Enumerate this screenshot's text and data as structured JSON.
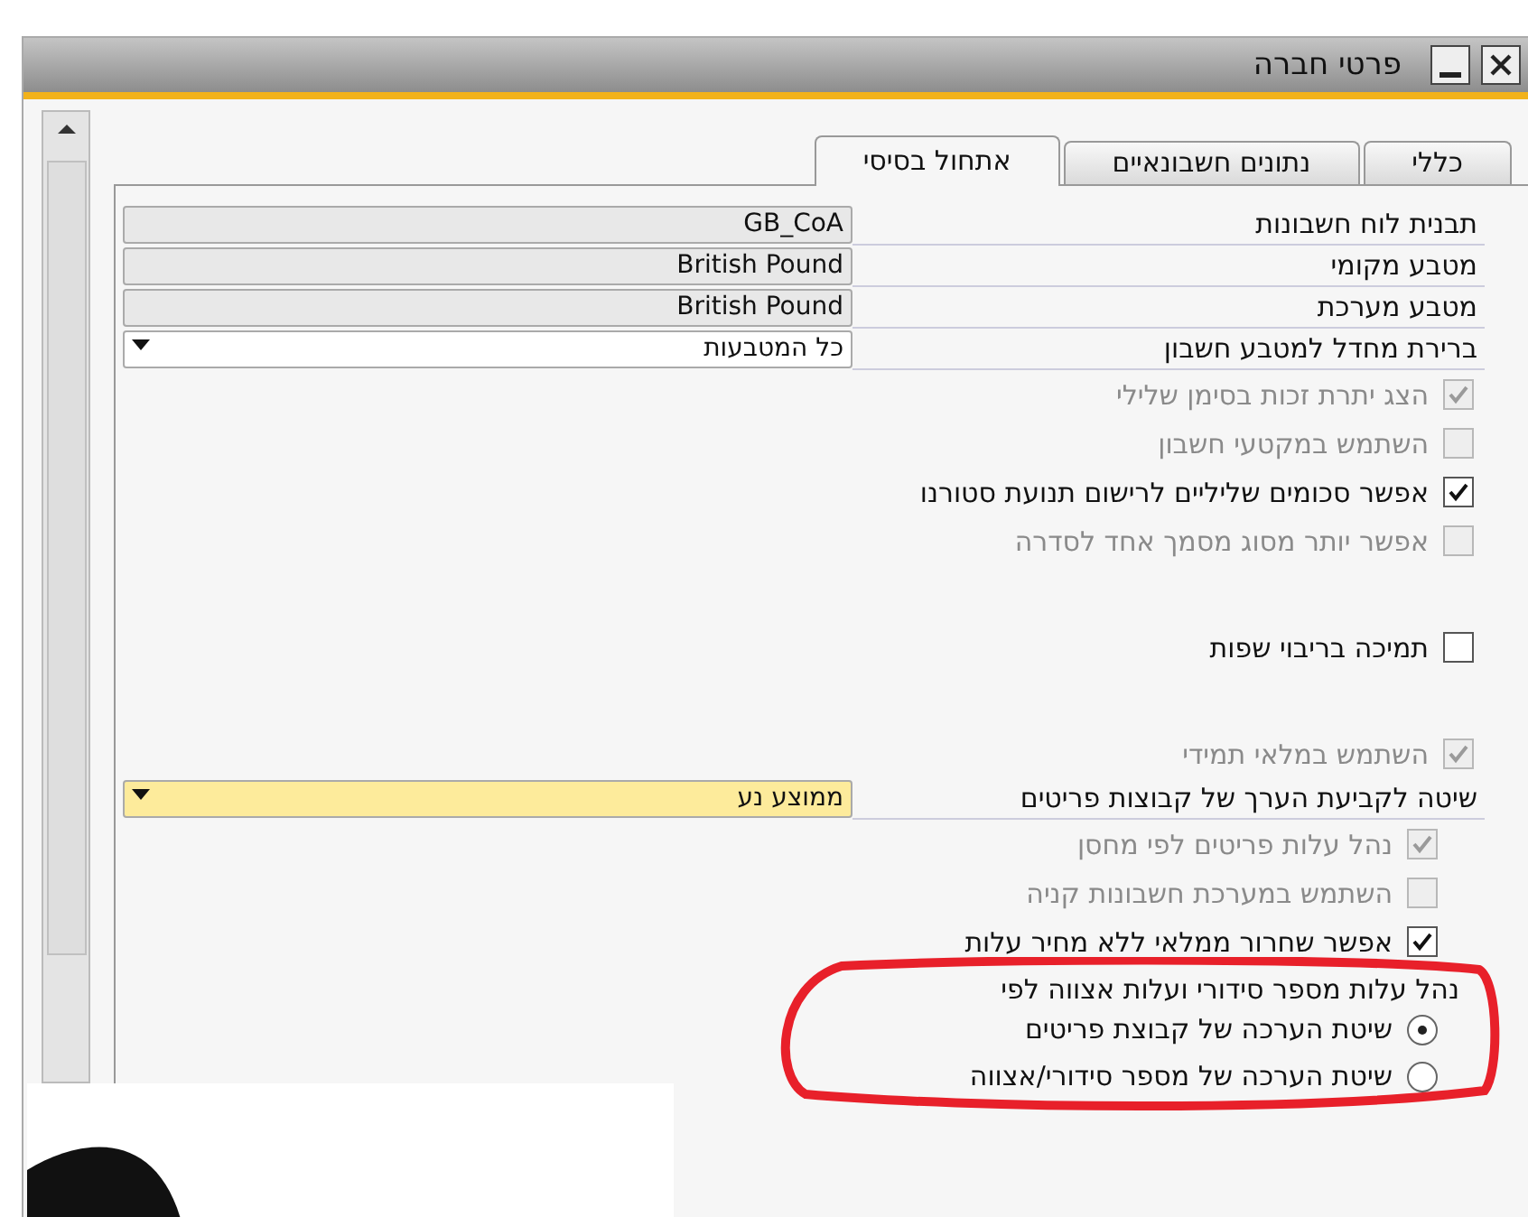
{
  "window": {
    "title": "פרטי חברה"
  },
  "tabs": [
    {
      "label": "כללי",
      "selected": false
    },
    {
      "label": "נתונים חשבונאיים",
      "selected": false
    },
    {
      "label": "אתחול בסיסי",
      "selected": true
    }
  ],
  "sections": [
    {
      "items": [
        {
          "kind": "field",
          "label": "תבנית לוח חשבונות",
          "value": "GB_CoA"
        },
        {
          "kind": "field",
          "label": "מטבע מקומי",
          "value": "British Pound"
        },
        {
          "kind": "field",
          "label": "מטבע מערכת",
          "value": "British Pound"
        },
        {
          "kind": "dropdown",
          "label": "ברירת מחדל למטבע חשבון",
          "value": "כל המטבעות",
          "highlighted": false
        },
        {
          "kind": "checkbox",
          "label": "הצג יתרת זכות בסימן שלילי",
          "checked": true,
          "disabled": true
        },
        {
          "kind": "checkbox",
          "label": "השתמש במקטעי חשבון",
          "checked": false,
          "disabled": true
        },
        {
          "kind": "checkbox",
          "label": "אפשר סכומים שליליים לרישום תנועת סטורנו",
          "checked": true,
          "disabled": false
        },
        {
          "kind": "checkbox",
          "label": "אפשר יותר מסוג מסמך אחד לסדרה",
          "checked": false,
          "disabled": true
        }
      ]
    },
    {
      "items": [
        {
          "kind": "checkbox",
          "label": "תמיכה בריבוי שפות",
          "checked": false,
          "disabled": false
        }
      ]
    },
    {
      "items": [
        {
          "kind": "checkbox",
          "label": "השתמש במלאי תמידי",
          "checked": true,
          "disabled": true
        },
        {
          "kind": "dropdown",
          "label": "שיטה לקביעת הערך של קבוצות פריטים",
          "value": "ממוצע נע",
          "highlighted": true,
          "children": [
            {
              "kind": "checkbox",
              "label": "נהל עלות פריטים לפי מחסן",
              "checked": true,
              "disabled": true
            },
            {
              "kind": "checkbox",
              "label": "השתמש במערכת חשבונות קניה",
              "checked": false,
              "disabled": true
            },
            {
              "kind": "checkbox",
              "label": "אפשר שחרור ממלאי ללא מחיר עלות",
              "checked": true,
              "disabled": false
            },
            {
              "kind": "radio-group",
              "label": "נהל עלות מספר סידורי ועלות אצווה לפי",
              "options": [
                {
                  "label": "שיטת הערכה של קבוצת פריטים",
                  "selected": true
                },
                {
                  "label": "שיטת הערכה של מספר סידורי/אצווה",
                  "selected": false
                }
              ]
            }
          ]
        }
      ]
    }
  ],
  "annotation": {
    "kind": "ellipse"
  }
}
